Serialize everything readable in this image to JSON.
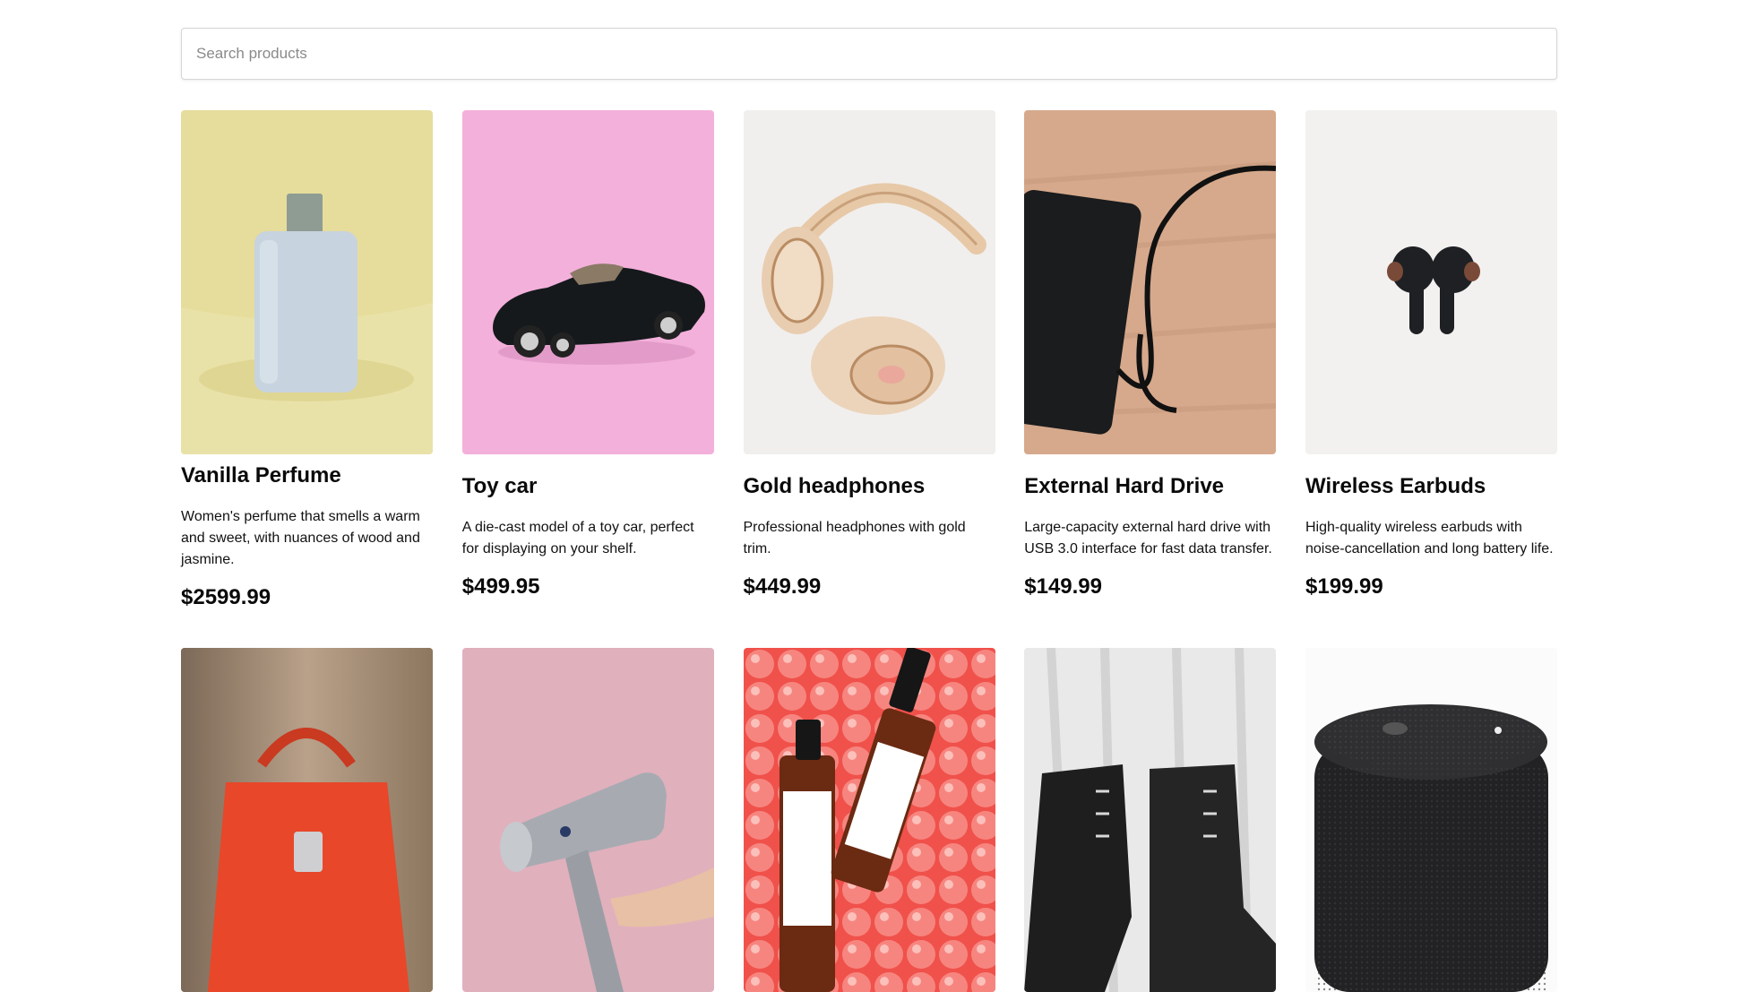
{
  "search": {
    "placeholder": "Search products"
  },
  "products": [
    {
      "title": "Vanilla Perfume",
      "description": "Women's perfume that smells a warm and sweet, with nuances of wood and jasmine.",
      "price": "$2599.99",
      "image_bg": "#e6dd9c",
      "image_icon": "perfume-bottle-image"
    },
    {
      "title": "Toy car",
      "description": "A die-cast model of a toy car, perfect for displaying on your shelf.",
      "price": "$499.95",
      "image_bg": "#f3b0da",
      "image_icon": "toy-car-image"
    },
    {
      "title": "Gold headphones",
      "description": "Professional headphones with gold trim.",
      "price": "$449.99",
      "image_bg": "#f1efed",
      "image_icon": "headphones-image"
    },
    {
      "title": "External Hard Drive",
      "description": "Large-capacity external hard drive with USB 3.0 interface for fast data transfer.",
      "price": "$149.99",
      "image_bg": "#d6a98c",
      "image_icon": "hard-drive-image"
    },
    {
      "title": "Wireless Earbuds",
      "description": "High-quality wireless earbuds with noise-cancellation and long battery life.",
      "price": "$199.99",
      "image_bg": "#f2f1f0",
      "image_icon": "earbuds-image"
    },
    {
      "image_icon": "handbag-image"
    },
    {
      "image_icon": "hair-dryer-image"
    },
    {
      "image_icon": "serum-bottles-image"
    },
    {
      "image_icon": "boots-image"
    },
    {
      "image_icon": "speaker-image"
    }
  ]
}
